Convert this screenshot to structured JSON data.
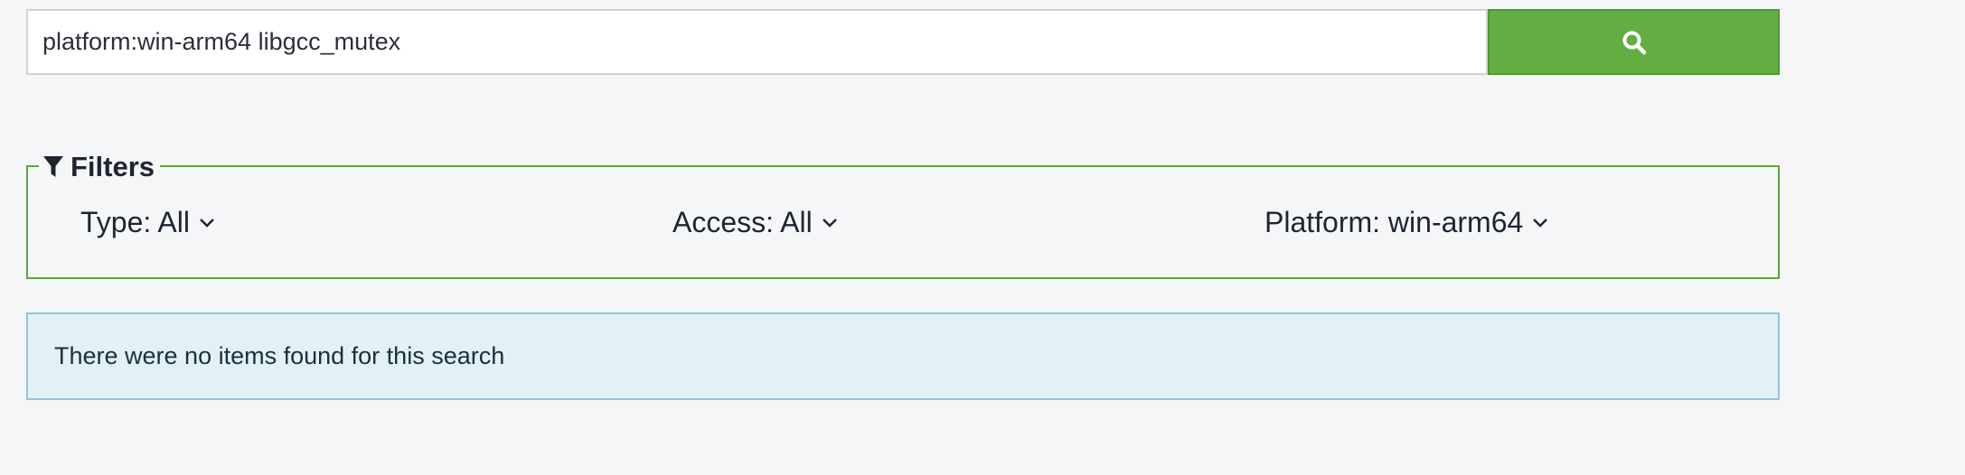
{
  "search": {
    "query": "platform:win-arm64 libgcc_mutex",
    "button_icon": "search-icon",
    "button_color": "#63ad43"
  },
  "filters": {
    "legend": "Filters",
    "legend_icon": "filter-icon",
    "border_color": "#5aa63e",
    "items": [
      {
        "label": "Type: All",
        "icon": "chevron-down-icon"
      },
      {
        "label": "Access: All",
        "icon": "chevron-down-icon"
      },
      {
        "label": "Platform: win-arm64",
        "icon": "chevron-down-icon"
      }
    ]
  },
  "notice": {
    "text": "There were no items found for this search",
    "background": "#e1f1f6"
  }
}
